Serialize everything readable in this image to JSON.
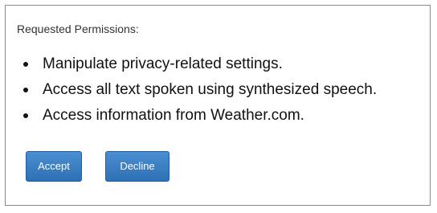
{
  "dialog": {
    "header": "Requested Permissions:",
    "permissions": [
      "Manipulate privacy-related settings.",
      "Access all text spoken using synthesized speech.",
      "Access information from Weather.com."
    ],
    "accept_label": "Accept",
    "decline_label": "Decline"
  },
  "colors": {
    "button_bg": "#3b80c4",
    "button_text": "#ffffff",
    "border": "#8a8a8a"
  }
}
